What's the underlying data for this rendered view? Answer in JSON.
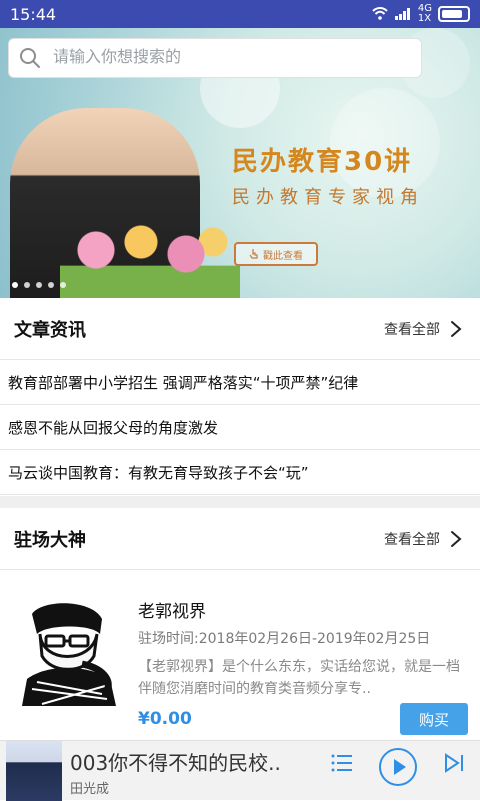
{
  "status_bar": {
    "time": "15:44",
    "network": "4G",
    "speed": "1X",
    "icons": [
      "wifi-icon",
      "signal-icon",
      "battery-icon"
    ]
  },
  "search": {
    "placeholder": "请输入你想搜索的",
    "icon": "search-icon"
  },
  "banner": {
    "title": "民办教育30讲",
    "subtitle": "民办教育专家视角",
    "button_label": "戳此查看",
    "dots_count": 5
  },
  "articles": {
    "title": "文章资讯",
    "view_all": "查看全部",
    "items": [
      "教育部部署中小学招生 强调严格落实“十项严禁”纪律",
      "感恩不能从回报父母的角度激发",
      "马云谈中国教育：有教无育导致孩子不会“玩”"
    ]
  },
  "experts": {
    "title": "驻场大神",
    "view_all": "查看全部",
    "card": {
      "name": "老郭视界",
      "time": "驻场时间:2018年02月26日-2019年02月25日",
      "description": "【老郭视界】是个什么东东，实话给您说，就是一档伴随您消磨时间的教育类音频分享专..",
      "price": "¥0.00",
      "buy_label": "购买"
    }
  },
  "player": {
    "title": "003你不得不知的民校..",
    "artist": "田光成",
    "icons": [
      "playlist-icon",
      "play-icon",
      "next-icon"
    ]
  },
  "colors": {
    "status_bar": "#3b4bb0",
    "accent_blue": "#2d8fe6",
    "buy_button": "#45a2e8",
    "banner_title": "#d5861c"
  }
}
